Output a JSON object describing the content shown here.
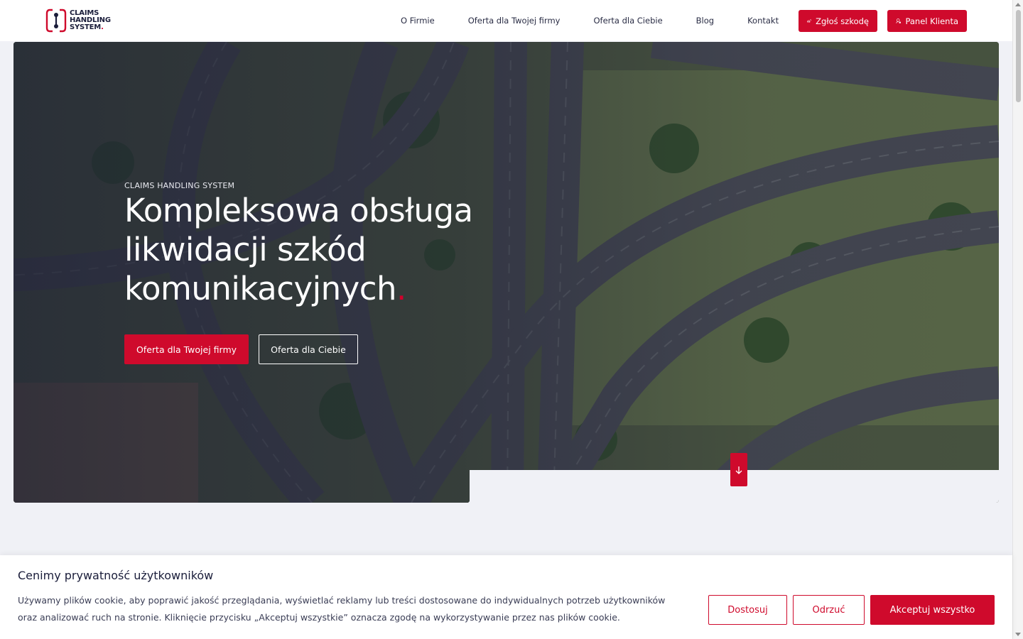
{
  "header": {
    "logo": {
      "line1": "CLAIMS",
      "line2": "HANDLING",
      "line3": "SYSTEM",
      "dot": "."
    },
    "nav": [
      "O Firmie",
      "Oferta dla Twojej firmy",
      "Oferta dla Ciebie",
      "Blog",
      "Kontakt"
    ],
    "report_button": "Zgłoś szkodę",
    "panel_button": "Panel Klienta"
  },
  "hero": {
    "eyebrow": "CLAIMS HANDLING SYSTEM",
    "title_line1": "Kompleksowa obsługa",
    "title_line2": "likwidacji szkód",
    "title_line3": "komunikacyjnych",
    "title_dot": ".",
    "primary_button": "Oferta dla Twojej firmy",
    "secondary_button": "Oferta dla Ciebie"
  },
  "cookie": {
    "title": "Cenimy prywatność użytkowników",
    "text": "Używamy plików cookie, aby poprawić jakość przeglądania, wyświetlać reklamy lub treści dostosowane do indywidualnych potrzeb użytkowników oraz analizować ruch na stronie. Kliknięcie przycisku „Akceptuj wszystkie” oznacza zgodę na wykorzystywanie przez nas plików cookie.",
    "customize": "Dostosuj",
    "reject": "Odrzuć",
    "accept": "Akceptuj wszystko"
  },
  "colors": {
    "accent": "#cf0a2c",
    "navy": "#1a1d3a",
    "page_bg": "#f0f1f6"
  },
  "icons": {
    "report": "car-crash-icon",
    "panel": "user-lock-icon",
    "scroll": "arrow-down-icon"
  }
}
